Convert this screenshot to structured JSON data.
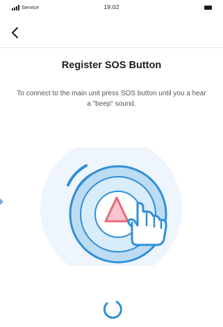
{
  "status_bar": {
    "carrier": "Service",
    "time": "19:02"
  },
  "nav": {
    "back_icon": "chevron-left-icon"
  },
  "main": {
    "title": "Register SOS Button",
    "instruction": "To connect to the main unit press SOS button until you a hear a \"beep\" sound."
  },
  "colors": {
    "accent_blue": "#2f8fd8",
    "light_blue": "#cfe6f8",
    "pale_blue": "#eef5fc",
    "alert_red": "#e66a78",
    "text_dark": "#1e1e1e",
    "text_gray": "#555555"
  }
}
